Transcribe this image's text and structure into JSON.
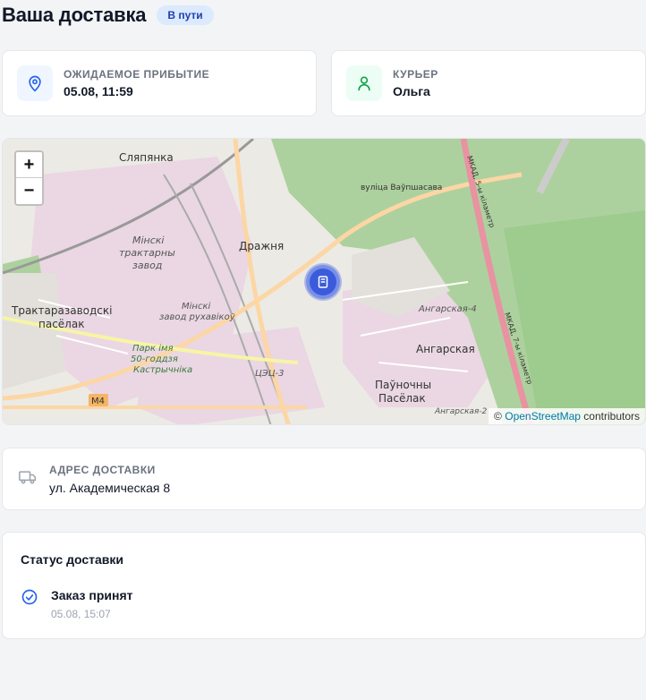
{
  "header": {
    "title": "Ваша доставка",
    "status_badge": "В пути"
  },
  "arrival": {
    "label": "Ожидаемое прибытие",
    "value": "05.08, 11:59",
    "icon": "location-pin-icon"
  },
  "courier": {
    "label": "Курьер",
    "value": "Ольга",
    "icon": "user-icon"
  },
  "map": {
    "zoom_in": "+",
    "zoom_out": "−",
    "attribution_prefix": "©",
    "attribution_link": "OpenStreetMap",
    "attribution_suffix": "contributors",
    "labels": {
      "slyapyanka": "Сляпянка",
      "street": "вуліца Ваўпшасава",
      "mkad5": "МКАД, 5-ы кіламетр",
      "mkad7": "МКАД, 7-ы кіламетр",
      "traktor1": "Мінскі",
      "traktor2": "трактарны",
      "traktor3": "завод",
      "drazhnya": "Дражня",
      "reductor1": "Мінскі",
      "reductor2": "завод рухавікоў",
      "traktorozavodsky1": "Трактаразаводскі",
      "traktorozavodsky2": "пасёлак",
      "park1": "Парк імя",
      "park2": "50-годдзя",
      "park3": "Кастрычніка",
      "tec": "ЦЭЦ-3",
      "angarskaya4": "Ангарская-4",
      "angarskaya": "Ангарская",
      "pauno1": "Паўночны",
      "pauno2": "Пасёлак",
      "angarskaya2": "Ангарская-2",
      "m4": "М4"
    },
    "colors": {
      "base": "#eceae4",
      "industrial": "#ead7e3",
      "forest": "#add19e",
      "road_major": "#fcd6a4",
      "mkad": "#e892a2",
      "marker": "#3b5bdb"
    }
  },
  "address": {
    "label": "Адрес доставки",
    "value": "ул. Академическая 8",
    "icon": "truck-icon"
  },
  "delivery_status": {
    "heading": "Статус доставки",
    "items": [
      {
        "title": "Заказ принят",
        "time": "05.08, 15:07",
        "icon": "check-circle-icon"
      }
    ]
  }
}
